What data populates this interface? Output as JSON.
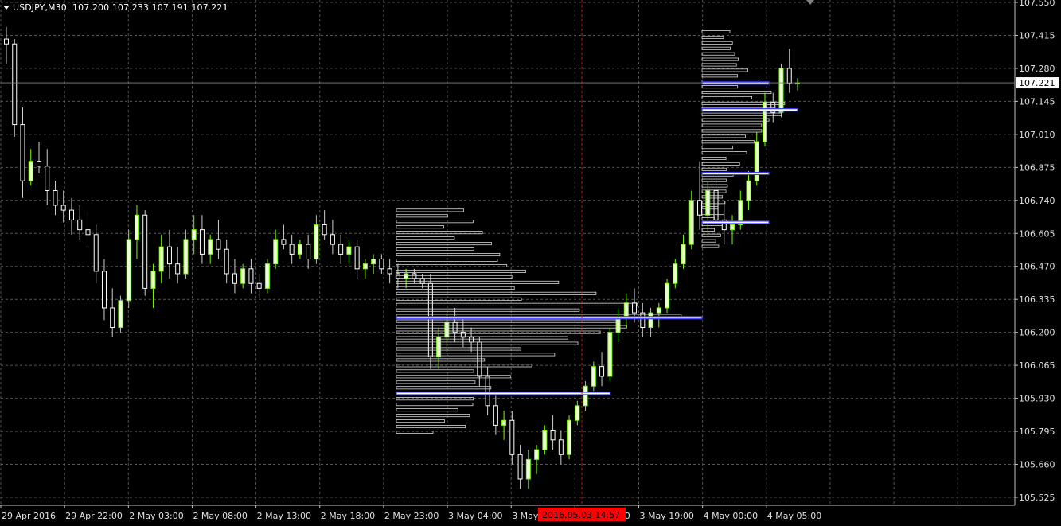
{
  "chart_data": {
    "type": "candlestick",
    "title": "USDJPY,M30",
    "ohlc_readout": "107.200 107.233 107.191 107.221",
    "current_price_label": "107.221",
    "crosshair_time_label": "2016.05.03 14:57",
    "ylim": [
      105.5,
      107.55
    ],
    "y_ticks": [
      "107.550",
      "107.415",
      "107.280",
      "107.145",
      "107.010",
      "106.875",
      "106.740",
      "106.605",
      "106.470",
      "106.335",
      "106.200",
      "106.065",
      "105.930",
      "105.795",
      "105.660",
      "105.525"
    ],
    "x_ticks": [
      "29 Apr 2016",
      "29 Apr 22:00",
      "2 May 03:00",
      "2 May 08:00",
      "2 May 13:00",
      "2 May 18:00",
      "2 May 23:00",
      "3 May 04:00",
      "3 May 09:00",
      "3 May 14:00",
      "3 May 19:00",
      "4 May 00:00",
      "4 May 05:00"
    ],
    "grid": true,
    "colors": {
      "bull": "#7CFC00",
      "bear": "#ffffff",
      "bear_body": "#ffffff",
      "bull_body": "#eaffd8",
      "grid": "#555555",
      "axis": "#c0c0c0",
      "profile": "#d8d8d8",
      "poc": "#3b3bff",
      "crosshair": "#b02020",
      "time_label_bg": "#ff0000"
    },
    "candles": [
      [
        107.4,
        107.45,
        107.3,
        107.38
      ],
      [
        107.38,
        107.4,
        107.0,
        107.05
      ],
      [
        107.05,
        107.12,
        106.75,
        106.82
      ],
      [
        106.82,
        106.95,
        106.8,
        106.9
      ],
      [
        106.9,
        106.98,
        106.85,
        106.88
      ],
      [
        106.88,
        106.95,
        106.72,
        106.78
      ],
      [
        106.78,
        106.82,
        106.68,
        106.72
      ],
      [
        106.72,
        106.78,
        106.65,
        106.7
      ],
      [
        106.7,
        106.75,
        106.6,
        106.66
      ],
      [
        106.66,
        106.72,
        106.58,
        106.62
      ],
      [
        106.62,
        106.7,
        106.55,
        106.6
      ],
      [
        106.6,
        106.64,
        106.4,
        106.45
      ],
      [
        106.45,
        106.5,
        106.25,
        106.3
      ],
      [
        106.3,
        106.38,
        106.18,
        106.22
      ],
      [
        106.22,
        106.35,
        106.2,
        106.33
      ],
      [
        106.33,
        106.62,
        106.3,
        106.58
      ],
      [
        106.58,
        106.72,
        106.5,
        106.68
      ],
      [
        106.68,
        106.7,
        106.35,
        106.38
      ],
      [
        106.38,
        106.48,
        106.3,
        106.45
      ],
      [
        106.45,
        106.6,
        106.4,
        106.55
      ],
      [
        106.55,
        106.62,
        106.42,
        106.48
      ],
      [
        106.48,
        106.55,
        106.4,
        106.44
      ],
      [
        106.44,
        106.62,
        106.42,
        106.58
      ],
      [
        106.58,
        106.68,
        106.52,
        106.62
      ],
      [
        106.62,
        106.68,
        106.48,
        106.52
      ],
      [
        106.52,
        106.6,
        106.48,
        106.58
      ],
      [
        106.58,
        106.66,
        106.5,
        106.54
      ],
      [
        106.54,
        106.58,
        106.4,
        106.44
      ],
      [
        106.44,
        106.5,
        106.36,
        106.4
      ],
      [
        106.4,
        106.48,
        106.38,
        106.46
      ],
      [
        106.46,
        106.5,
        106.36,
        106.4
      ],
      [
        106.4,
        106.44,
        106.34,
        106.38
      ],
      [
        106.38,
        106.5,
        106.36,
        106.48
      ],
      [
        106.48,
        106.62,
        106.46,
        106.58
      ],
      [
        106.58,
        106.64,
        106.54,
        106.56
      ],
      [
        106.56,
        106.6,
        106.48,
        106.52
      ],
      [
        106.52,
        106.58,
        106.5,
        106.56
      ],
      [
        106.56,
        106.6,
        106.46,
        106.5
      ],
      [
        106.5,
        106.68,
        106.48,
        106.64
      ],
      [
        106.64,
        106.7,
        106.58,
        106.6
      ],
      [
        106.6,
        106.66,
        106.52,
        106.56
      ],
      [
        106.56,
        106.6,
        106.48,
        106.52
      ],
      [
        106.52,
        106.58,
        106.48,
        106.55
      ],
      [
        106.55,
        106.58,
        106.42,
        106.46
      ],
      [
        106.46,
        106.5,
        106.42,
        106.48
      ],
      [
        106.48,
        106.52,
        106.44,
        106.5
      ],
      [
        106.5,
        106.52,
        106.44,
        106.46
      ],
      [
        106.46,
        106.5,
        106.4,
        106.44
      ],
      [
        106.44,
        106.48,
        106.38,
        106.42
      ],
      [
        106.42,
        106.46,
        106.38,
        106.44
      ],
      [
        106.44,
        106.46,
        106.4,
        106.42
      ],
      [
        106.42,
        106.44,
        106.38,
        106.4
      ],
      [
        106.4,
        106.44,
        106.05,
        106.1
      ],
      [
        106.1,
        106.22,
        106.05,
        106.18
      ],
      [
        106.18,
        106.28,
        106.12,
        106.24
      ],
      [
        106.24,
        106.3,
        106.16,
        106.2
      ],
      [
        106.2,
        106.26,
        106.14,
        106.18
      ],
      [
        106.18,
        106.22,
        106.12,
        106.16
      ],
      [
        106.16,
        106.18,
        105.98,
        106.02
      ],
      [
        106.02,
        106.06,
        105.86,
        105.9
      ],
      [
        105.9,
        105.94,
        105.78,
        105.82
      ],
      [
        105.82,
        105.88,
        105.76,
        105.84
      ],
      [
        105.84,
        105.88,
        105.66,
        105.7
      ],
      [
        105.7,
        105.74,
        105.56,
        105.6
      ],
      [
        105.6,
        105.72,
        105.56,
        105.68
      ],
      [
        105.68,
        105.74,
        105.62,
        105.72
      ],
      [
        105.72,
        105.82,
        105.7,
        105.8
      ],
      [
        105.8,
        105.86,
        105.72,
        105.76
      ],
      [
        105.76,
        105.8,
        105.66,
        105.7
      ],
      [
        105.7,
        105.86,
        105.68,
        105.84
      ],
      [
        105.84,
        105.92,
        105.82,
        105.9
      ],
      [
        105.9,
        106.0,
        105.88,
        105.98
      ],
      [
        105.98,
        106.08,
        105.96,
        106.06
      ],
      [
        106.06,
        106.12,
        105.98,
        106.02
      ],
      [
        106.02,
        106.22,
        106.0,
        106.2
      ],
      [
        106.2,
        106.3,
        106.16,
        106.26
      ],
      [
        106.26,
        106.36,
        106.22,
        106.32
      ],
      [
        106.32,
        106.38,
        106.24,
        106.28
      ],
      [
        106.28,
        106.32,
        106.18,
        106.22
      ],
      [
        106.22,
        106.3,
        106.18,
        106.28
      ],
      [
        106.28,
        106.32,
        106.22,
        106.3
      ],
      [
        106.3,
        106.42,
        106.28,
        106.4
      ],
      [
        106.4,
        106.5,
        106.38,
        106.48
      ],
      [
        106.48,
        106.6,
        106.46,
        106.56
      ],
      [
        106.56,
        106.78,
        106.54,
        106.74
      ],
      [
        106.74,
        106.9,
        106.62,
        106.68
      ],
      [
        106.68,
        106.82,
        106.6,
        106.78
      ],
      [
        106.78,
        106.84,
        106.62,
        106.66
      ],
      [
        106.66,
        106.74,
        106.56,
        106.62
      ],
      [
        106.62,
        106.68,
        106.56,
        106.64
      ],
      [
        106.64,
        106.78,
        106.62,
        106.74
      ],
      [
        106.74,
        106.86,
        106.7,
        106.82
      ],
      [
        106.82,
        107.02,
        106.8,
        106.98
      ],
      [
        106.98,
        107.18,
        106.96,
        107.14
      ],
      [
        107.14,
        107.18,
        107.06,
        107.1
      ],
      [
        107.1,
        107.3,
        107.08,
        107.28
      ],
      [
        107.28,
        107.36,
        107.18,
        107.22
      ],
      [
        107.22,
        107.24,
        107.19,
        107.221
      ]
    ],
    "profiles": [
      {
        "session": "2 May",
        "poc": 106.26,
        "value_lines": [
          105.95,
          106.26
        ],
        "rows": 41,
        "low": 105.79,
        "high": 106.72
      },
      {
        "session": "4 May",
        "poc": 107.11,
        "value_lines": [
          107.22,
          107.11,
          106.85,
          106.65
        ],
        "rows": 40,
        "low": 106.55,
        "high": 107.45
      }
    ]
  }
}
